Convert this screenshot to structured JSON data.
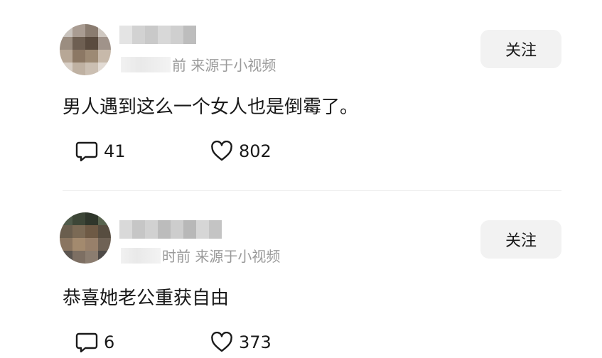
{
  "comments": [
    {
      "meta_suffix": "前 来源于小视频",
      "follow_label": "关注",
      "text": "男人遇到这么一个女人也是倒霉了。",
      "reply_count": "41",
      "like_count": "802"
    },
    {
      "meta_suffix": "时前 来源于小视频",
      "follow_label": "关注",
      "text": "恭喜她老公重获自由",
      "reply_count": "6",
      "like_count": "373"
    }
  ],
  "icons": {
    "reply": "comment-bubble-icon",
    "like": "heart-outline-icon"
  },
  "colors": {
    "follow_bg": "#f2f2f2",
    "meta_text": "#9a9a9a",
    "text": "#1a1a1a"
  }
}
